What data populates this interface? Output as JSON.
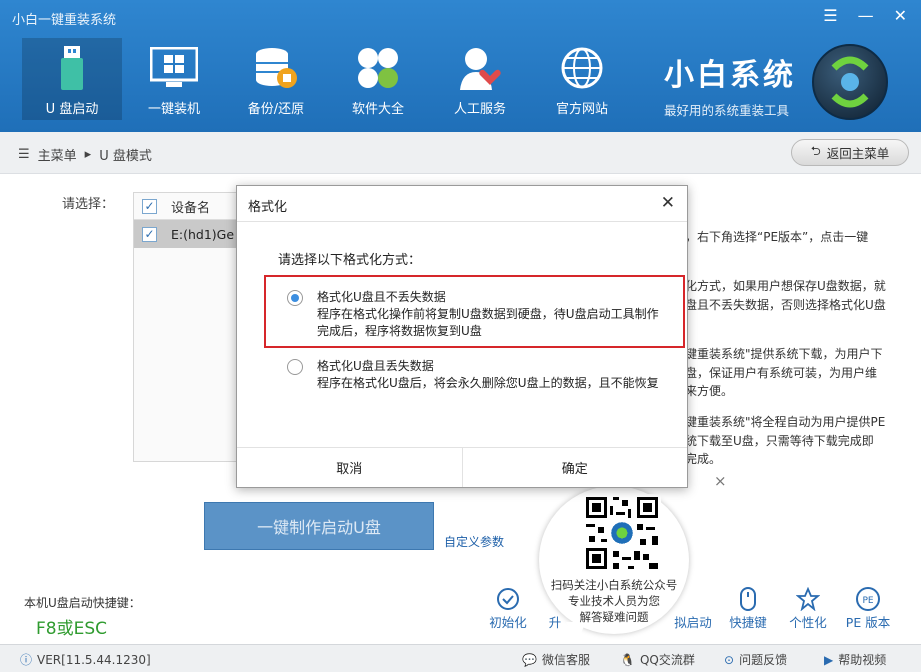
{
  "app": {
    "title": "小白一键重装系统"
  },
  "nav": [
    {
      "label": "U 盘启动",
      "icon": "usb-drive-icon"
    },
    {
      "label": "一键装机",
      "icon": "monitor-windows-icon"
    },
    {
      "label": "备份/还原",
      "icon": "database-icon"
    },
    {
      "label": "软件大全",
      "icon": "clover-apps-icon"
    },
    {
      "label": "人工服务",
      "icon": "support-person-icon"
    },
    {
      "label": "官方网站",
      "icon": "globe-icon"
    }
  ],
  "brand": {
    "title": "小白系统",
    "subtitle": "最好用的系统重装工具"
  },
  "breadcrumb": {
    "root": "主菜单",
    "current": "U 盘模式"
  },
  "back_button": "返回主菜单",
  "main": {
    "select_label": "请选择：",
    "table_header": "设备名",
    "device_row": "E:(hd1)Ge",
    "help_lines": [
      "，右下角选择“PE版本”，点击一键",
      "化方式，如果用户想保存U盘数据，就",
      "盘且不丢失数据，否则选择格式化U盘",
      "键重装系统\"提供系统下载，为用户下",
      "盘，保证用户有系统可装，为用户维",
      "来方便。",
      "键重装系统\"将全程自动为用户提供PE",
      "统下载至U盘，只需等待下载完成即",
      "完成。"
    ],
    "panel_close": "×",
    "make_button": "一键制作启动U盘",
    "custom_params": "自定义参数",
    "hotkey_label": "本机U盘启动快捷键：",
    "hotkey_value": "F8或ESC"
  },
  "tools": [
    {
      "label": "初始化",
      "icon": "check-circle-icon"
    },
    {
      "label": "升",
      "icon": "upgrade-icon"
    },
    {
      "label": "拟启动",
      "icon": "simulate-boot-icon"
    },
    {
      "label": "快捷键",
      "icon": "mouse-icon"
    },
    {
      "label": "个性化",
      "icon": "personalize-icon"
    },
    {
      "label": "PE 版本",
      "icon": "pe-badge-icon"
    }
  ],
  "status": {
    "version": "VER[11.5.44.1230]",
    "wechat": "微信客服",
    "qq": "QQ交流群",
    "feedback": "问题反馈",
    "help_video": "帮助视频"
  },
  "qr": {
    "lines": [
      "扫码关注小白系统公众号",
      "专业技术人员为您",
      "解答疑难问题"
    ]
  },
  "modal": {
    "title": "格式化",
    "prompt": "请选择以下格式化方式：",
    "option1": {
      "title": "格式化U盘且不丢失数据",
      "desc": "程序在格式化操作前将复制U盘数据到硬盘，待U盘启动工具制作完成后，程序将数据恢复到U盘",
      "selected": true
    },
    "option2": {
      "title": "格式化U盘且丢失数据",
      "desc": "程序在格式化U盘后，将会永久删除您U盘上的数据，且不能恢复",
      "selected": false
    },
    "cancel": "取消",
    "confirm": "确定"
  }
}
